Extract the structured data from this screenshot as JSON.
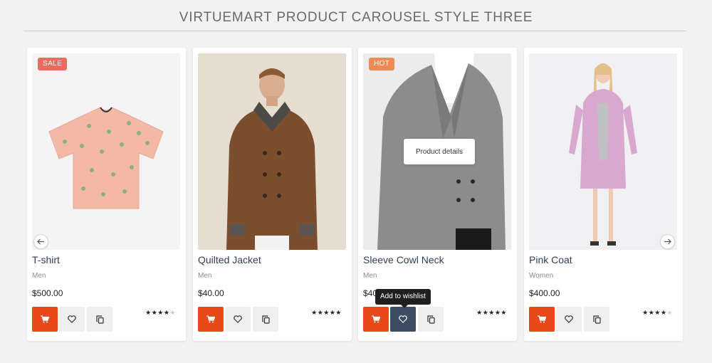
{
  "heading": "VIRTUEMART PRODUCT CAROUSEL STYLE THREE",
  "products": [
    {
      "name": "T-shirt",
      "category": "Men",
      "price": "$500.00",
      "badge": "SALE",
      "rating": 4,
      "image": "pink-tshirt-icon"
    },
    {
      "name": "Quilted Jacket",
      "category": "Men",
      "price": "$40.00",
      "badge": "",
      "rating": 5,
      "image": "brown-jacket-icon"
    },
    {
      "name": "Sleeve Cowl Neck",
      "category": "Men",
      "price": "$40.00",
      "badge": "HOT",
      "rating": 5,
      "image": "grey-blazer-icon",
      "hover_label": "Product details",
      "wishlist_tooltip": "Add to wishlist"
    },
    {
      "name": "Pink Coat",
      "category": "Women",
      "price": "$400.00",
      "badge": "",
      "rating": 4,
      "image": "pink-coat-icon"
    }
  ],
  "colors": {
    "cart_button": "#e8481a",
    "wishlist_active": "#3b4c63",
    "badge_sale": "#e86d5e",
    "badge_hot": "#ef8a55"
  },
  "icons": {
    "cart": "cart-icon",
    "wishlist": "heart-icon",
    "compare": "compare-icon",
    "prev": "arrow-left-icon",
    "next": "arrow-right-icon"
  }
}
